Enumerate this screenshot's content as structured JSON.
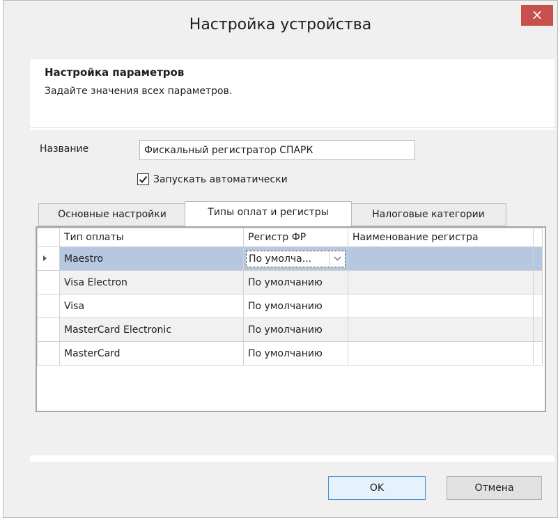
{
  "window": {
    "title": "Настройка устройства",
    "close_label": "×"
  },
  "header": {
    "title": "Настройка параметров",
    "subtitle": "Задайте значения всех параметров."
  },
  "form": {
    "name_label": "Название",
    "name_value": "Фискальный регистратор СПАРК",
    "autostart_label": "Запускать автоматически",
    "autostart_checked": true
  },
  "tabs": [
    {
      "label": "Основные настройки",
      "active": false
    },
    {
      "label": "Типы оплат и регистры",
      "active": true
    },
    {
      "label": "Налоговые категории",
      "active": false
    }
  ],
  "grid": {
    "columns": [
      "Тип оплаты",
      "Регистр ФР",
      "Наименование регистра"
    ],
    "rows": [
      {
        "payment_type": "Maestro",
        "register": "По умолча...",
        "register_name": "",
        "selected": true
      },
      {
        "payment_type": "Visa Electron",
        "register": "По умолчанию",
        "register_name": ""
      },
      {
        "payment_type": "Visa",
        "register": "По умолчанию",
        "register_name": ""
      },
      {
        "payment_type": "MasterCard Electronic",
        "register": "По умолчанию",
        "register_name": ""
      },
      {
        "payment_type": "MasterCard",
        "register": "По умолчанию",
        "register_name": ""
      }
    ]
  },
  "buttons": {
    "ok": "OK",
    "cancel": "Отмена"
  },
  "colors": {
    "close": "#c7504c",
    "selection": "#b6c8e1",
    "default_button_border": "#3c8fd6"
  }
}
